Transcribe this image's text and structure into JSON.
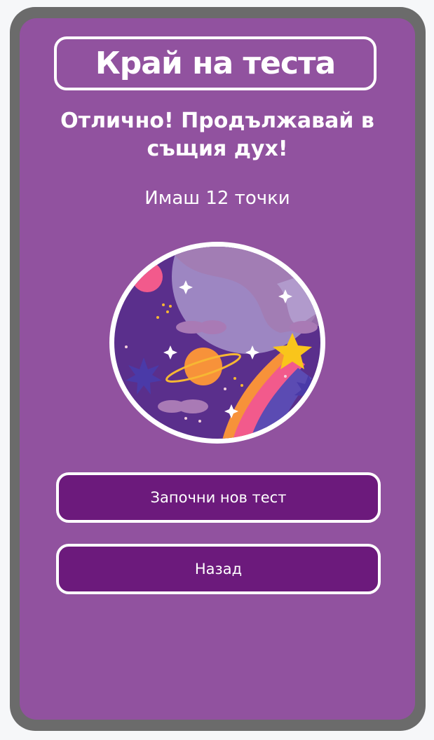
{
  "header": {
    "title": "Край на теста"
  },
  "result": {
    "message": "Отлично! Продължавай в същия дух!",
    "score_text": "Имаш 12 точки"
  },
  "illustration": {
    "icon": "space-illustration"
  },
  "actions": {
    "new_test_label": "Започни нов тест",
    "back_label": "Назад"
  },
  "colors": {
    "screen_bg": "#91529f",
    "button_bg": "#6c1a7c",
    "frame": "#6b6b6b"
  }
}
